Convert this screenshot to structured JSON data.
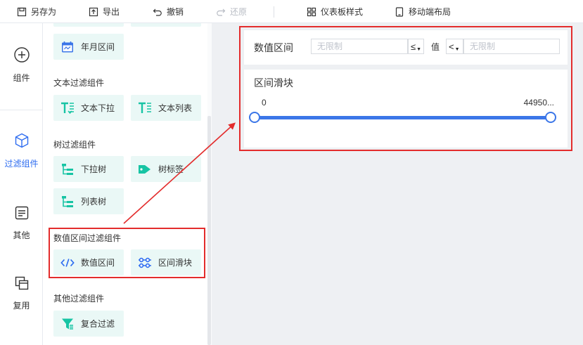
{
  "toolbar": {
    "items": [
      {
        "label": "另存为",
        "icon": "save-as-icon",
        "enabled": true
      },
      {
        "label": "导出",
        "icon": "export-icon",
        "enabled": true
      },
      {
        "label": "撤销",
        "icon": "undo-icon",
        "enabled": true
      },
      {
        "label": "还原",
        "icon": "redo-icon",
        "enabled": false
      },
      {
        "label": "仪表板样式",
        "icon": "dashboard-style-icon",
        "enabled": true
      },
      {
        "label": "移动端布局",
        "icon": "mobile-layout-icon",
        "enabled": true
      }
    ]
  },
  "rail": {
    "items": [
      {
        "label": "组件",
        "icon": "plus-circle-icon",
        "active": false
      },
      {
        "label": "过滤组件",
        "icon": "cube-icon",
        "active": true
      },
      {
        "label": "其他",
        "icon": "document-icon",
        "active": false
      },
      {
        "label": "复用",
        "icon": "copy-icon",
        "active": false
      }
    ]
  },
  "panel": {
    "date_widget": {
      "label": "年月区间",
      "icon": "calendar-icon"
    },
    "sections": [
      {
        "title": "文本过滤组件",
        "widgets": [
          {
            "label": "文本下拉",
            "icon": "text-dropdown-icon"
          },
          {
            "label": "文本列表",
            "icon": "text-list-icon"
          }
        ]
      },
      {
        "title": "树过滤组件",
        "widgets": [
          {
            "label": "下拉树",
            "icon": "dropdown-tree-icon"
          },
          {
            "label": "树标签",
            "icon": "tree-tag-icon"
          },
          {
            "label": "列表树",
            "icon": "list-tree-icon"
          }
        ]
      },
      {
        "title": "数值区间过滤组件",
        "widgets": [
          {
            "label": "数值区间",
            "icon": "code-icon"
          },
          {
            "label": "区间滑块",
            "icon": "slider-icon"
          }
        ]
      },
      {
        "title": "其他过滤组件",
        "widgets": [
          {
            "label": "复合过滤",
            "icon": "funnel-icon"
          }
        ]
      }
    ]
  },
  "canvas": {
    "numeric_range": {
      "title": "数值区间",
      "min_placeholder": "无限制",
      "min_operator": "≤",
      "value_label": "值",
      "max_operator": "<",
      "max_placeholder": "无限制"
    },
    "range_slider": {
      "title": "区间滑块",
      "min_value": "0",
      "max_value": "44950..."
    }
  },
  "colors": {
    "accent": "#2d6cf0",
    "widget_bg": "#eaf8f6",
    "widget_icon": "#17c4a4",
    "annotation": "#e32c2c",
    "canvas_bg": "#eef0f3"
  }
}
